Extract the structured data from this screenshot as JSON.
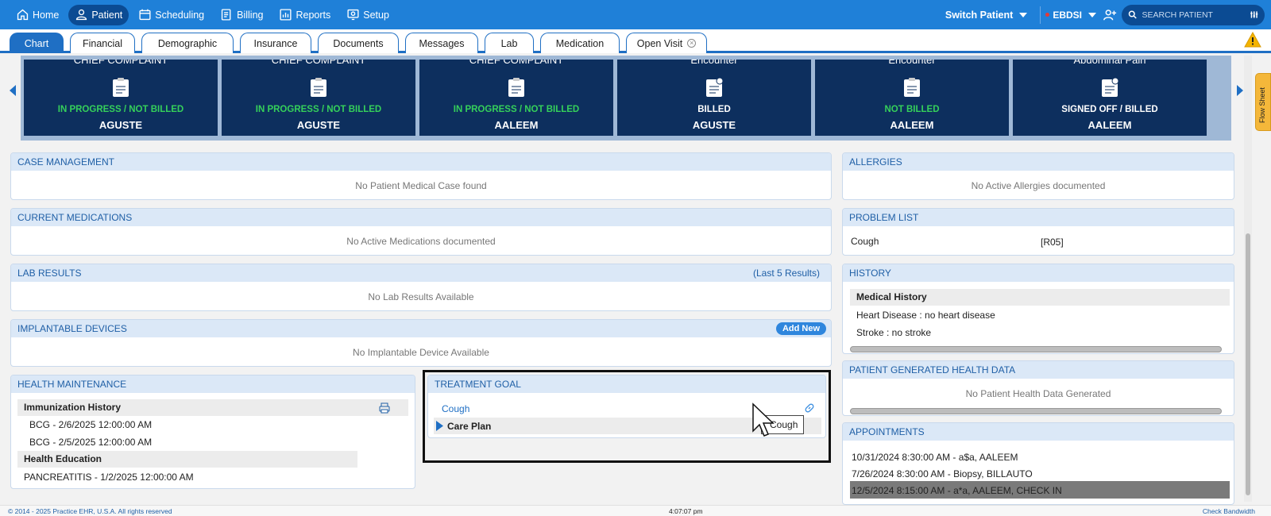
{
  "nav": {
    "items": [
      {
        "label": "Home",
        "icon": "home-icon"
      },
      {
        "label": "Patient",
        "icon": "user-icon"
      },
      {
        "label": "Scheduling",
        "icon": "calendar-icon"
      },
      {
        "label": "Billing",
        "icon": "billing-icon"
      },
      {
        "label": "Reports",
        "icon": "reports-icon"
      },
      {
        "label": "Setup",
        "icon": "setup-icon"
      }
    ],
    "switch_patient": "Switch Patient",
    "org": "EBDSI",
    "search_placeholder": "SEARCH PATIENT"
  },
  "tabs": [
    {
      "label": "Chart"
    },
    {
      "label": "Financial"
    },
    {
      "label": "Demographic"
    },
    {
      "label": "Insurance"
    },
    {
      "label": "Documents"
    },
    {
      "label": "Messages"
    },
    {
      "label": "Lab"
    },
    {
      "label": "Medication"
    },
    {
      "label": "Open Visit"
    }
  ],
  "encounters": [
    {
      "title": "CHIEF COMPLAINT",
      "status": "IN PROGRESS / NOT BILLED",
      "status_color": "#35d05a",
      "provider": "AGUSTE"
    },
    {
      "title": "CHIEF COMPLAINT",
      "status": "IN PROGRESS / NOT BILLED",
      "status_color": "#35d05a",
      "provider": "AGUSTE"
    },
    {
      "title": "CHIEF COMPLAINT",
      "status": "IN PROGRESS / NOT BILLED",
      "status_color": "#35d05a",
      "provider": "AALEEM"
    },
    {
      "title": "Encounter",
      "status": "BILLED",
      "status_color": "#ffffff",
      "provider": "AGUSTE"
    },
    {
      "title": "Encounter",
      "status": "NOT BILLED",
      "status_color": "#35d05a",
      "provider": "AALEEM"
    },
    {
      "title": "Abdominal Pain",
      "status": "SIGNED OFF / BILLED",
      "status_color": "#ffffff",
      "provider": "AALEEM"
    }
  ],
  "flow_sheet": "Flow Sheet",
  "case_management": {
    "title": "CASE MANAGEMENT",
    "empty": "No Patient Medical Case found"
  },
  "current_medications": {
    "title": "CURRENT MEDICATIONS",
    "empty": "No Active Medications documented"
  },
  "lab_results": {
    "title": "LAB RESULTS",
    "right": "(Last 5 Results)",
    "empty": "No Lab Results Available"
  },
  "implantable_devices": {
    "title": "IMPLANTABLE DEVICES",
    "add_new": "Add New",
    "empty": "No Implantable Device Available"
  },
  "health_maintenance": {
    "title": "HEALTH MAINTENANCE",
    "immunization_heading": "Immunization History",
    "immunizations": [
      "BCG - 2/6/2025 12:00:00 AM",
      "BCG - 2/5/2025 12:00:00 AM"
    ],
    "education_heading": "Health Education",
    "education": [
      "PANCREATITIS - 1/2/2025 12:00:00 AM"
    ]
  },
  "treatment_goal": {
    "title": "TREATMENT GOAL",
    "goal": "Cough",
    "care_plan": "Care Plan",
    "tooltip": "Cough"
  },
  "allergies": {
    "title": "ALLERGIES",
    "empty": "No Active Allergies documented"
  },
  "problem_list": {
    "title": "PROBLEM LIST",
    "problem": "Cough",
    "code": "[R05]"
  },
  "history": {
    "title": "HISTORY",
    "medical_heading": "Medical History",
    "items": [
      "Heart Disease : no heart disease",
      "Stroke : no stroke"
    ]
  },
  "patient_generated": {
    "title": "PATIENT GENERATED HEALTH DATA",
    "empty": "No Patient Health Data Generated"
  },
  "appointments": {
    "title": "APPOINTMENTS",
    "items": [
      "10/31/2024 8:30:00 AM - a$a, AALEEM",
      "7/26/2024 8:30:00 AM - Biopsy, BILLAUTO",
      "12/5/2024 8:15:00 AM - a*a, AALEEM, CHECK IN"
    ]
  },
  "footer": {
    "copyright": "© 2014 - 2025 Practice EHR, U.S.A. All rights reserved",
    "time": "4:07:07 pm",
    "bandwidth": "Check Bandwidth"
  }
}
